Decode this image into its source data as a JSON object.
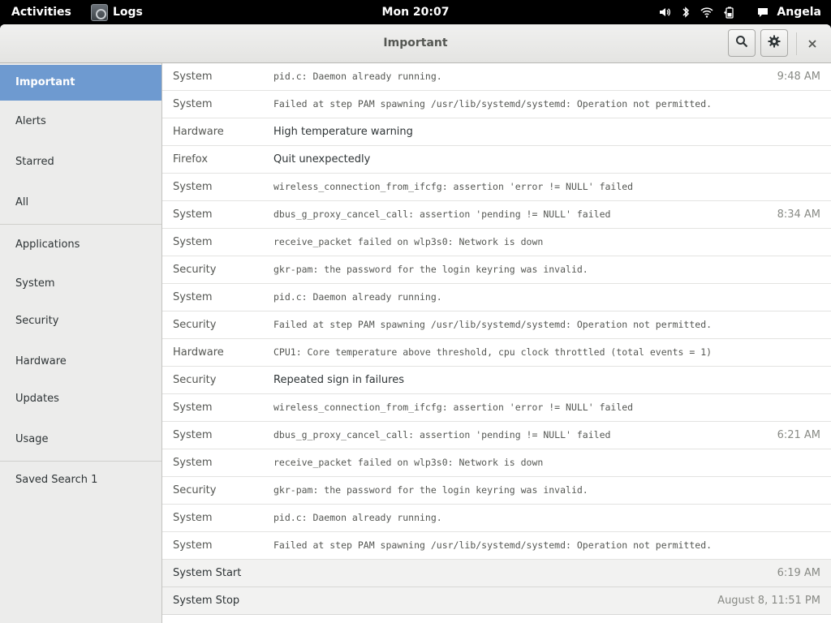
{
  "topbar": {
    "activities": "Activities",
    "app_name": "Logs",
    "clock": "Mon 20:07",
    "user": "Angela",
    "icons": [
      "volume-icon",
      "bluetooth-icon",
      "wifi-icon",
      "battery-icon",
      "chat-icon"
    ]
  },
  "window": {
    "title": "Important"
  },
  "sidebar": {
    "items": [
      {
        "label": "Important",
        "selected": true
      },
      {
        "label": "Alerts"
      },
      {
        "label": "Starred"
      },
      {
        "label": "All"
      },
      {
        "label": "Applications"
      },
      {
        "label": "System"
      },
      {
        "label": "Security"
      },
      {
        "label": "Hardware"
      },
      {
        "label": "Updates"
      },
      {
        "label": "Usage"
      },
      {
        "label": "Saved Search 1"
      }
    ]
  },
  "log": {
    "rows": [
      {
        "category": "System",
        "message": "pid.c: Daemon already running.",
        "time": "9:48 AM"
      },
      {
        "category": "System",
        "message": "Failed at step PAM spawning /usr/lib/systemd/systemd: Operation not permitted.",
        "time": ""
      },
      {
        "category": "Hardware",
        "message": "High temperature warning",
        "time": ""
      },
      {
        "category": "Firefox",
        "message": "Quit unexpectedly",
        "time": ""
      },
      {
        "category": "System",
        "message": "wireless_connection_from_ifcfg: assertion 'error != NULL' failed",
        "time": ""
      },
      {
        "category": "System",
        "message": "dbus_g_proxy_cancel_call: assertion 'pending != NULL' failed",
        "time": "8:34 AM"
      },
      {
        "category": "System",
        "message": "receive_packet failed on wlp3s0: Network is down",
        "time": ""
      },
      {
        "category": "Security",
        "message": "gkr-pam: the password for the login keyring was invalid.",
        "time": ""
      },
      {
        "category": "System",
        "message": "pid.c: Daemon already running.",
        "time": ""
      },
      {
        "category": "Security",
        "message": "Failed at step PAM spawning /usr/lib/systemd/systemd: Operation not permitted.",
        "time": ""
      },
      {
        "category": "Hardware",
        "message": "CPU1: Core temperature above threshold, cpu clock throttled (total events = 1)",
        "time": ""
      },
      {
        "category": "Security",
        "message": "Repeated sign in failures",
        "time": ""
      },
      {
        "category": "System",
        "message": "wireless_connection_from_ifcfg: assertion 'error != NULL' failed",
        "time": ""
      },
      {
        "category": "System",
        "message": "dbus_g_proxy_cancel_call: assertion 'pending != NULL' failed",
        "time": "6:21 AM"
      },
      {
        "category": "System",
        "message": "receive_packet failed on wlp3s0: Network is down",
        "time": ""
      },
      {
        "category": "Security",
        "message": "gkr-pam: the password for the login keyring was invalid.",
        "time": ""
      },
      {
        "category": "System",
        "message": "pid.c: Daemon already running.",
        "time": ""
      },
      {
        "category": "System",
        "message": "Failed at step PAM spawning /usr/lib/systemd/systemd: Operation not permitted.",
        "time": ""
      }
    ],
    "events": [
      {
        "label": "System Start",
        "time": "6:19 AM"
      },
      {
        "label": "System Stop",
        "time": "August 8, 11:51 PM"
      }
    ]
  }
}
